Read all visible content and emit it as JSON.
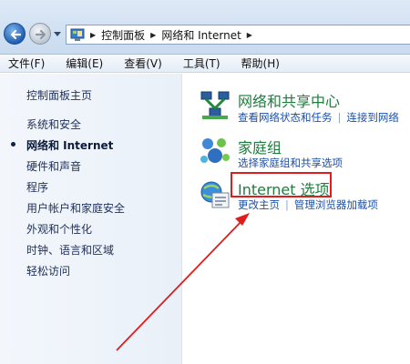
{
  "address": {
    "crumbs": [
      "控制面板",
      "网络和 Internet"
    ]
  },
  "menu": [
    "文件(F)",
    "编辑(E)",
    "查看(V)",
    "工具(T)",
    "帮助(H)"
  ],
  "sidebar": {
    "items": [
      {
        "label": "控制面板主页",
        "current": false
      },
      {
        "label": "系统和安全",
        "current": false
      },
      {
        "label": "网络和 Internet",
        "current": true
      },
      {
        "label": "硬件和声音",
        "current": false
      },
      {
        "label": "程序",
        "current": false
      },
      {
        "label": "用户帐户和家庭安全",
        "current": false
      },
      {
        "label": "外观和个性化",
        "current": false
      },
      {
        "label": "时钟、语言和区域",
        "current": false
      },
      {
        "label": "轻松访问",
        "current": false
      }
    ]
  },
  "categories": [
    {
      "title": "网络和共享中心",
      "icon": "network-icon",
      "links": [
        "查看网络状态和任务",
        "连接到网络"
      ]
    },
    {
      "title": "家庭组",
      "icon": "homegroup-icon",
      "links": [
        "选择家庭组和共享选项"
      ]
    },
    {
      "title": "Internet 选项",
      "icon": "internet-options-icon",
      "links": [
        "更改主页",
        "管理浏览器加载项"
      ]
    }
  ],
  "colors": {
    "category_title": "#1e7d3d",
    "link": "#1a4fa8",
    "annotation": "#e01c1c"
  }
}
